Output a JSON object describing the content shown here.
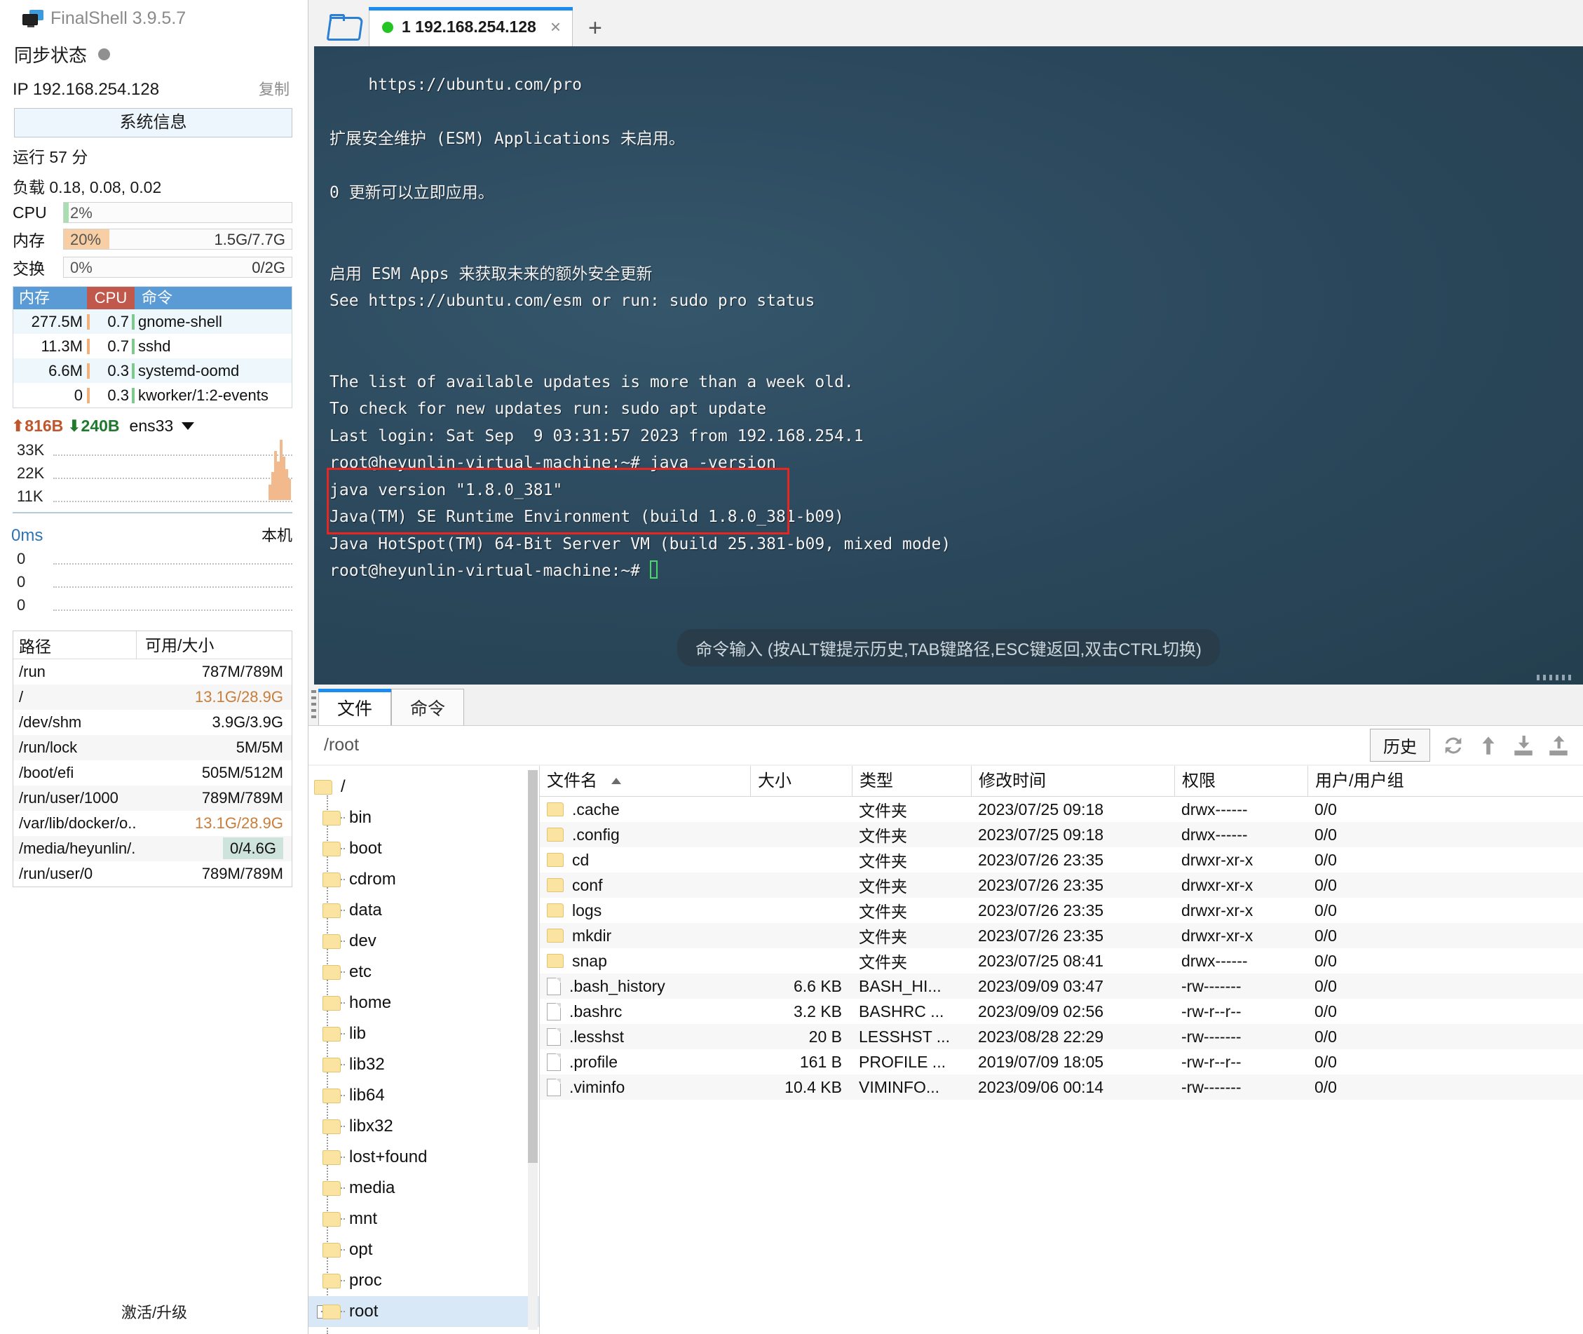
{
  "app": {
    "title": "FinalShell 3.9.5.7",
    "icon": "monitor-icon"
  },
  "sidebar": {
    "sync_label": "同步状态",
    "ip_label": "IP 192.168.254.128",
    "copy_label": "复制",
    "sysinfo_button": "系统信息",
    "uptime": "运行 57 分",
    "load": "负载 0.18, 0.08, 0.02",
    "meters": [
      {
        "label": "CPU",
        "pct": "2%",
        "fill": 2,
        "right": "",
        "color": "#a9dfb0"
      },
      {
        "label": "内存",
        "pct": "20%",
        "fill": 20,
        "right": "1.5G/7.7G",
        "color": "#f8cfa4"
      },
      {
        "label": "交换",
        "pct": "0%",
        "fill": 0,
        "right": "0/2G",
        "color": "#f8cfa4"
      }
    ],
    "process_table": {
      "headers": [
        "内存",
        "CPU",
        "命令"
      ],
      "rows": [
        {
          "mem": "277.5M",
          "cpu": "0.7",
          "cmd": "gnome-shell"
        },
        {
          "mem": "11.3M",
          "cpu": "0.7",
          "cmd": "sshd"
        },
        {
          "mem": "6.6M",
          "cpu": "0.3",
          "cmd": "systemd-oomd"
        },
        {
          "mem": "0",
          "cpu": "0.3",
          "cmd": "kworker/1:2-events"
        }
      ]
    },
    "network": {
      "up": "816B",
      "down": "240B",
      "interface": "ens33",
      "scale_labels": [
        "33K",
        "22K",
        "11K"
      ]
    },
    "latency": {
      "value": "0ms",
      "local_label": "本机",
      "scale_labels": [
        "0",
        "0",
        "0"
      ]
    },
    "disk_table": {
      "headers": [
        "路径",
        "可用/大小"
      ],
      "rows": [
        {
          "path": "/run",
          "value": "787M/789M",
          "highlight": false
        },
        {
          "path": "/",
          "value": "13.1G/28.9G",
          "highlight": false,
          "orange": true
        },
        {
          "path": "/dev/shm",
          "value": "3.9G/3.9G",
          "highlight": false
        },
        {
          "path": "/run/lock",
          "value": "5M/5M",
          "highlight": false
        },
        {
          "path": "/boot/efi",
          "value": "505M/512M",
          "highlight": false
        },
        {
          "path": "/run/user/1000",
          "value": "789M/789M",
          "highlight": false
        },
        {
          "path": "/var/lib/docker/o...",
          "value": "13.1G/28.9G",
          "highlight": false,
          "orange": true
        },
        {
          "path": "/media/heyunlin/...",
          "value": "0/4.6G",
          "highlight": true
        },
        {
          "path": "/run/user/0",
          "value": "789M/789M",
          "highlight": false
        }
      ]
    },
    "activate_label": "激活/升级"
  },
  "tabbar": {
    "folder_icon": "open-folder-icon",
    "tab_label": "1 192.168.254.128",
    "close_icon": "×",
    "new_tab_icon": "+"
  },
  "terminal": {
    "lines": [
      "    https://ubuntu.com/pro",
      "",
      "扩展安全维护 (ESM) Applications 未启用。",
      "",
      "0 更新可以立即应用。",
      "",
      "",
      "启用 ESM Apps 来获取未来的额外安全更新",
      "See https://ubuntu.com/esm or run: sudo pro status",
      "",
      "",
      "The list of available updates is more than a week old.",
      "To check for new updates run: sudo apt update",
      "Last login: Sat Sep  9 03:31:57 2023 from 192.168.254.1",
      "root@heyunlin-virtual-machine:~# java -version",
      "java version \"1.8.0_381\"",
      "Java(TM) SE Runtime Environment (build 1.8.0_381-b09)",
      "Java HotSpot(TM) 64-Bit Server VM (build 25.381-b09, mixed mode)"
    ],
    "prompt": "root@heyunlin-virtual-machine:~# ",
    "input_hint": "命令输入 (按ALT键提示历史,TAB键路径,ESC键返回,双击CTRL切换)",
    "highlight_color": "#e8251f"
  },
  "filepanel": {
    "tabs": [
      {
        "label": "文件",
        "active": true
      },
      {
        "label": "命令",
        "active": false
      }
    ],
    "path": "/root",
    "history_button": "历史",
    "toolbar_icons": [
      "refresh-icon",
      "up-arrow-icon",
      "download-icon",
      "upload-icon"
    ],
    "tree": {
      "root": "/",
      "nodes": [
        "bin",
        "boot",
        "cdrom",
        "data",
        "dev",
        "etc",
        "home",
        "lib",
        "lib32",
        "lib64",
        "libx32",
        "lost+found",
        "media",
        "mnt",
        "opt",
        "proc",
        "root"
      ],
      "selected": "root"
    },
    "table": {
      "headers": [
        "文件名",
        "大小",
        "类型",
        "修改时间",
        "权限",
        "用户/用户组"
      ],
      "sort_column": "文件名",
      "rows": [
        {
          "icon": "folder",
          "name": ".cache",
          "size": "",
          "type": "文件夹",
          "time": "2023/07/25 09:18",
          "perm": "drwx------",
          "user": "0/0"
        },
        {
          "icon": "folder",
          "name": ".config",
          "size": "",
          "type": "文件夹",
          "time": "2023/07/25 09:18",
          "perm": "drwx------",
          "user": "0/0"
        },
        {
          "icon": "folder",
          "name": "cd",
          "size": "",
          "type": "文件夹",
          "time": "2023/07/26 23:35",
          "perm": "drwxr-xr-x",
          "user": "0/0"
        },
        {
          "icon": "folder",
          "name": "conf",
          "size": "",
          "type": "文件夹",
          "time": "2023/07/26 23:35",
          "perm": "drwxr-xr-x",
          "user": "0/0"
        },
        {
          "icon": "folder",
          "name": "logs",
          "size": "",
          "type": "文件夹",
          "time": "2023/07/26 23:35",
          "perm": "drwxr-xr-x",
          "user": "0/0"
        },
        {
          "icon": "folder",
          "name": "mkdir",
          "size": "",
          "type": "文件夹",
          "time": "2023/07/26 23:35",
          "perm": "drwxr-xr-x",
          "user": "0/0"
        },
        {
          "icon": "folder",
          "name": "snap",
          "size": "",
          "type": "文件夹",
          "time": "2023/07/25 08:41",
          "perm": "drwx------",
          "user": "0/0"
        },
        {
          "icon": "file",
          "name": ".bash_history",
          "size": "6.6 KB",
          "type": "BASH_HI...",
          "time": "2023/09/09 03:47",
          "perm": "-rw-------",
          "user": "0/0"
        },
        {
          "icon": "file",
          "name": ".bashrc",
          "size": "3.2 KB",
          "type": "BASHRC ...",
          "time": "2023/09/09 02:56",
          "perm": "-rw-r--r--",
          "user": "0/0"
        },
        {
          "icon": "file",
          "name": ".lesshst",
          "size": "20 B",
          "type": "LESSHST ...",
          "time": "2023/08/28 22:29",
          "perm": "-rw-------",
          "user": "0/0"
        },
        {
          "icon": "file",
          "name": ".profile",
          "size": "161 B",
          "type": "PROFILE ...",
          "time": "2019/07/09 18:05",
          "perm": "-rw-r--r--",
          "user": "0/0"
        },
        {
          "icon": "file",
          "name": ".viminfo",
          "size": "10.4 KB",
          "type": "VIMINFO...",
          "time": "2023/09/06 00:14",
          "perm": "-rw-------",
          "user": "0/0"
        }
      ]
    }
  }
}
